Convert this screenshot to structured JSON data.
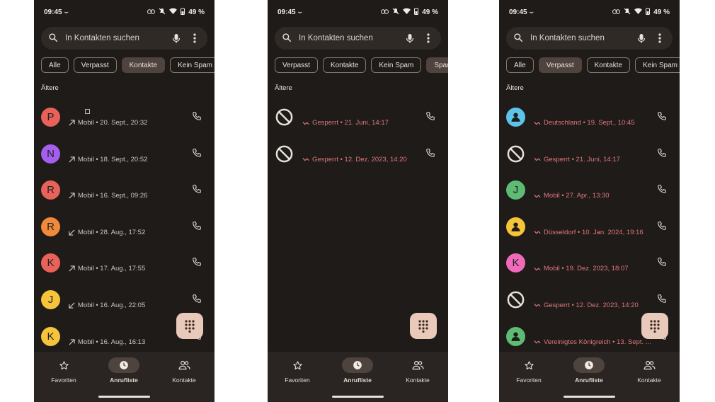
{
  "screens": [
    {
      "status": {
        "time": "09:45",
        "battery": "49 %"
      },
      "search": {
        "placeholder": "In Kontakten suchen"
      },
      "chips": [
        {
          "label": "Alle",
          "selected": false
        },
        {
          "label": "Verpasst",
          "selected": false
        },
        {
          "label": "Kontakte",
          "selected": true
        },
        {
          "label": "Kein Spam",
          "selected": false
        }
      ],
      "section": "Ältere",
      "rows": [
        {
          "letter": "P",
          "color": "#e8625a",
          "direction": "outgoing",
          "detail": "Mobil • 20. Sept., 20:32",
          "red": false,
          "sim": true
        },
        {
          "letter": "N",
          "color": "#a45ff0",
          "direction": "outgoing",
          "detail": "Mobil • 18. Sept., 20:52",
          "red": false
        },
        {
          "letter": "R",
          "color": "#e8625a",
          "direction": "outgoing",
          "detail": "Mobil • 16. Sept., 09:26",
          "red": false
        },
        {
          "letter": "R",
          "color": "#f08a3a",
          "direction": "incoming",
          "detail": "Mobil • 28. Aug., 17:52",
          "red": false
        },
        {
          "letter": "K",
          "color": "#e8625a",
          "direction": "outgoing",
          "detail": "Mobil • 17. Aug., 17:55",
          "red": false
        },
        {
          "letter": "J",
          "color": "#f5c43a",
          "direction": "incoming",
          "detail": "Mobil • 16. Aug., 22:05",
          "red": false
        },
        {
          "letter": "K",
          "color": "#f5c43a",
          "direction": "outgoing",
          "detail": "Mobil • 16. Aug., 16:13",
          "red": false
        }
      ]
    },
    {
      "status": {
        "time": "09:45",
        "battery": "49 %"
      },
      "search": {
        "placeholder": "In Kontakten suchen"
      },
      "chips": [
        {
          "label": "Verpasst",
          "selected": false
        },
        {
          "label": "Kontakte",
          "selected": false
        },
        {
          "label": "Kein Spam",
          "selected": false
        },
        {
          "label": "Spam",
          "selected": true
        }
      ],
      "section": "Ältere",
      "rows": [
        {
          "blocked": true,
          "direction": "missed",
          "detail": "Gesperrt • 21. Juni, 14:17",
          "red": true
        },
        {
          "blocked": true,
          "direction": "missed",
          "detail": "Gesperrt • 12. Dez. 2023, 14:20",
          "red": true
        }
      ]
    },
    {
      "status": {
        "time": "09:45",
        "battery": "49 %"
      },
      "search": {
        "placeholder": "In Kontakten suchen"
      },
      "chips": [
        {
          "label": "Alle",
          "selected": false
        },
        {
          "label": "Verpasst",
          "selected": true
        },
        {
          "label": "Kontakte",
          "selected": false
        },
        {
          "label": "Kein Spam",
          "selected": false
        }
      ],
      "section": "Ältere",
      "rows": [
        {
          "person": true,
          "color": "#5bc4e8",
          "direction": "missed",
          "detail": "Deutschland • 19. Sept., 10:45",
          "red": true
        },
        {
          "blocked": true,
          "direction": "missed",
          "detail": "Gesperrt • 21. Juni, 14:17",
          "red": true
        },
        {
          "letter": "J",
          "color": "#5dbb74",
          "direction": "missed",
          "detail": "Mobil • 27. Apr., 13:30",
          "red": true
        },
        {
          "person": true,
          "color": "#f5c43a",
          "direction": "missed",
          "detail": "Düsseldorf • 10. Jan. 2024, 19:16",
          "red": true
        },
        {
          "letter": "K",
          "color": "#ef6ab8",
          "direction": "missed",
          "detail": "Mobil • 19. Dez. 2023, 18:07",
          "red": true
        },
        {
          "blocked": true,
          "direction": "missed",
          "detail": "Gesperrt • 12. Dez. 2023, 14:20",
          "red": true
        },
        {
          "person": true,
          "color": "#5dbb74",
          "direction": "missed",
          "detail": "Vereinigtes Königreich • 13. Sept. ...",
          "red": true
        }
      ]
    }
  ],
  "nav": [
    {
      "label": "Favoriten",
      "icon": "star-icon",
      "active": false
    },
    {
      "label": "Anrufliste",
      "icon": "clock-icon",
      "active": true
    },
    {
      "label": "Kontakte",
      "icon": "people-icon",
      "active": false
    }
  ]
}
